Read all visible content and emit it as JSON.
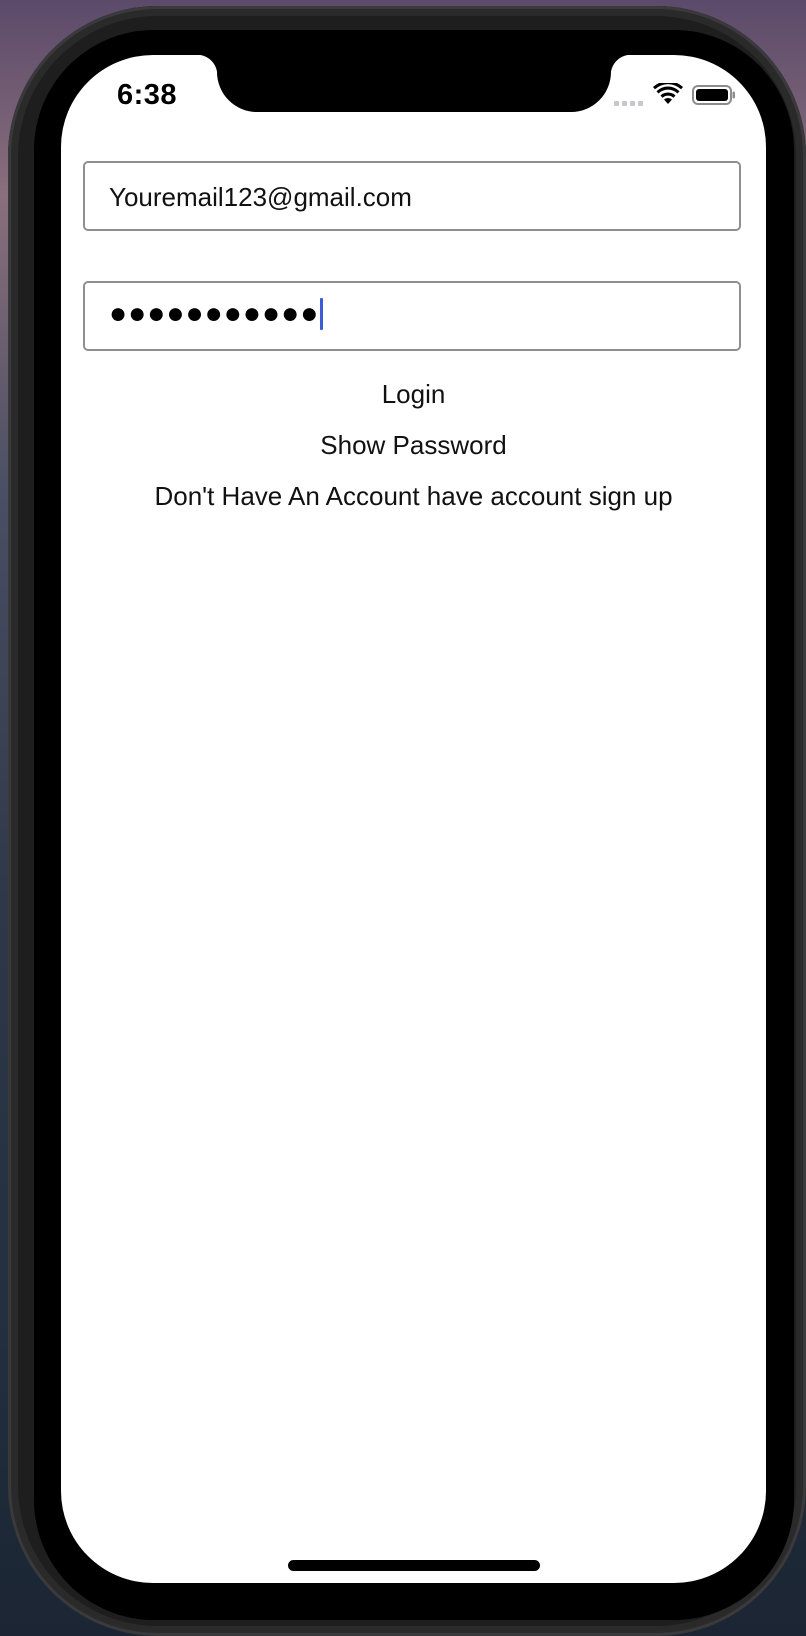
{
  "status_bar": {
    "time": "6:38",
    "icons": [
      "signal-icon",
      "wifi-icon",
      "battery-icon"
    ]
  },
  "login_form": {
    "email_value": "Youremail123@gmail.com",
    "password_masked": "●●●●●●●●●●●",
    "login_label": "Login",
    "show_password_label": "Show Password",
    "signup_label": "Don't Have An Account have account sign up"
  },
  "colors": {
    "cursor": "#3b5bdb",
    "field_border": "#8e8e93"
  }
}
